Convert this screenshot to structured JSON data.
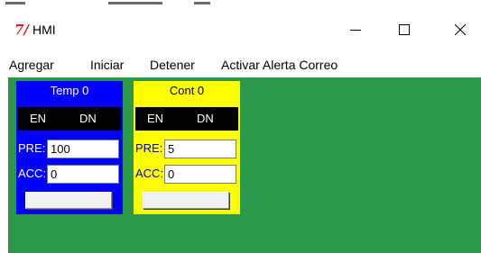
{
  "window": {
    "title": "HMI",
    "app_icon": "tk-feather-icon",
    "controls": {
      "minimize_icon": "minimize-icon",
      "maximize_icon": "maximize-icon",
      "close_icon": "close-icon"
    }
  },
  "menu": {
    "items": [
      {
        "label": "Agregar"
      },
      {
        "label": "Iniciar"
      },
      {
        "label": "Detener"
      },
      {
        "label": "Activar Alerta Correo"
      }
    ]
  },
  "colors": {
    "canvas": "#2a9a4a",
    "timer_panel": "#0000ff",
    "counter_panel": "#ffff00",
    "status_row": "#000000"
  },
  "panels": [
    {
      "title": "Temp 0",
      "en_label": "EN",
      "dn_label": "DN",
      "pre_label": "PRE:",
      "pre_value": "100",
      "acc_label": "ACC:",
      "acc_value": "0",
      "button_label": ""
    },
    {
      "title": "Cont 0",
      "en_label": "EN",
      "dn_label": "DN",
      "pre_label": "PRE:",
      "pre_value": "5",
      "acc_label": "ACC:",
      "acc_value": "0",
      "button_label": ""
    }
  ]
}
